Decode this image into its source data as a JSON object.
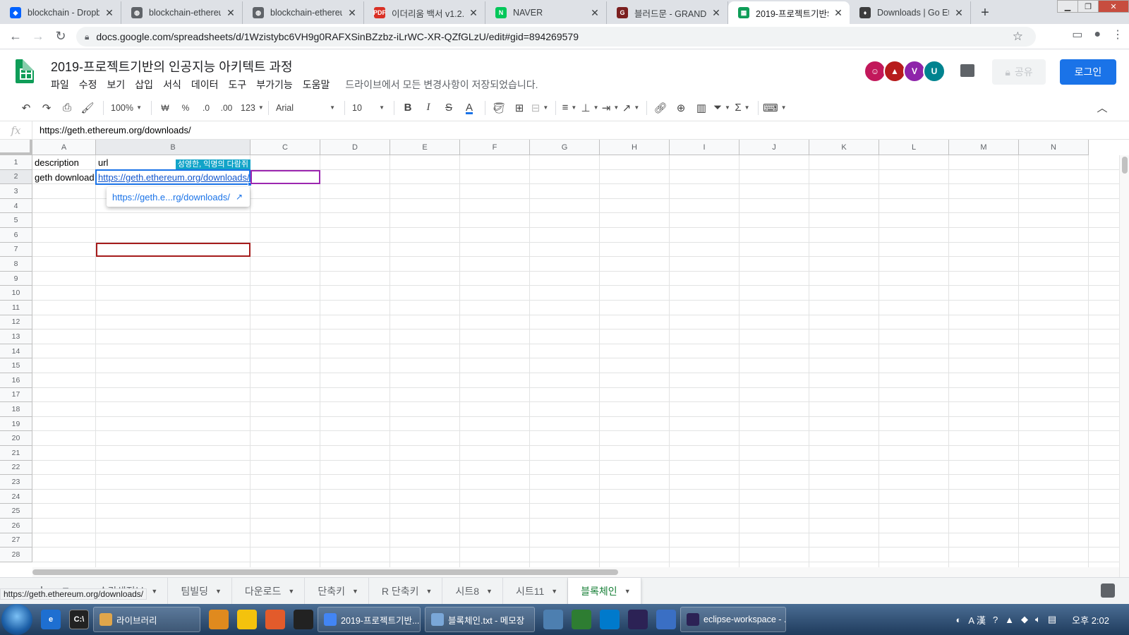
{
  "browser": {
    "tabs": [
      {
        "title": "blockchain - Dropbo",
        "icon": "dropbox-icon",
        "color": "#0061fe",
        "glyph": "◆"
      },
      {
        "title": "blockchain-ethereum",
        "icon": "globe-icon",
        "color": "#5f6368",
        "glyph": "◍"
      },
      {
        "title": "blockchain-ethereum",
        "icon": "globe-icon",
        "color": "#5f6368",
        "glyph": "◍"
      },
      {
        "title": "이더리움 백서 v1.2.p",
        "icon": "pdf-icon",
        "color": "#d93025",
        "glyph": "PDF"
      },
      {
        "title": "NAVER",
        "icon": "naver-icon",
        "color": "#03c75a",
        "glyph": "N"
      },
      {
        "title": "블러드문 - GRAND",
        "icon": "grand-icon",
        "color": "#7b1f1f",
        "glyph": "G"
      },
      {
        "title": "2019-프로젝트기반S",
        "icon": "sheets-icon",
        "color": "#0f9d58",
        "glyph": "▦",
        "active": true
      },
      {
        "title": "Downloads | Go Eth",
        "icon": "ethereum-icon",
        "color": "#3c3c3d",
        "glyph": "♦"
      }
    ],
    "url": "docs.google.com/spreadsheets/d/1Wzistybc6VH9g0RAFXSinBZzbz-iLrWC-XR-QZfGLzU/edit#gid=894269579"
  },
  "doc": {
    "title": "2019-프로젝트기반의 인공지능 아키텍트 과정",
    "menus": [
      "파일",
      "수정",
      "보기",
      "삽입",
      "서식",
      "데이터",
      "도구",
      "부가기능",
      "도움말"
    ],
    "saved_status": "드라이브에서 모든 변경사항이 저장되었습니다.",
    "share_label": "공유",
    "login_label": "로그인",
    "avatars": [
      {
        "color": "#c2185b",
        "glyph": "☺"
      },
      {
        "color": "#b71c1c",
        "glyph": "▲"
      },
      {
        "color": "#8e24aa",
        "glyph": "V"
      },
      {
        "color": "#00838f",
        "glyph": "U"
      }
    ]
  },
  "toolbar": {
    "zoom": "100%",
    "currency": "₩",
    "percent": "%",
    "dec_minus": ".0",
    "dec_plus": ".00",
    "format_more": "123",
    "font": "Arial",
    "font_size": "10",
    "bold": "B",
    "italic": "I",
    "strike": "S",
    "text_color": "A"
  },
  "formula": {
    "fx": "fx",
    "value": "https://geth.ethereum.org/downloads/"
  },
  "grid": {
    "columns": [
      "A",
      "B",
      "C",
      "D",
      "E",
      "F",
      "G",
      "H",
      "I",
      "J",
      "K",
      "L",
      "M",
      "N"
    ],
    "rows": [
      "1",
      "2",
      "3",
      "4",
      "5",
      "6",
      "7",
      "8",
      "9",
      "10",
      "11",
      "12",
      "13",
      "14",
      "15",
      "16",
      "17",
      "18",
      "19",
      "20",
      "21",
      "22",
      "23",
      "24",
      "25",
      "26",
      "27",
      "28"
    ],
    "cells": {
      "A1": "description",
      "B1": "url",
      "A2": "geth download",
      "B2": "https://geth.ethereum.org/downloads/"
    },
    "collaborator_label": "성영한, 익명의 다람쥐",
    "link_preview": "https://geth.e...rg/downloads/",
    "colors": {
      "selection": "#1a73e8",
      "collaborator": "#12a4c8",
      "collaborator_box": "#9c27b0",
      "other_selection": "#a61c1c"
    }
  },
  "sheets": {
    "tabs": [
      {
        "label": "수강생정보"
      },
      {
        "label": "팀빌딩"
      },
      {
        "label": "다운로드"
      },
      {
        "label": "단축키"
      },
      {
        "label": "R 단축키"
      },
      {
        "label": "시트8"
      },
      {
        "label": "시트11"
      },
      {
        "label": "블록체인",
        "active": true
      }
    ],
    "status_url": "https://geth.ethereum.org/downloads/"
  },
  "taskbar": {
    "items": [
      {
        "label": "라이브러리",
        "color": "#e0a64b"
      },
      {
        "label": "2019-프로젝트기반...",
        "color": "#4285f4"
      },
      {
        "label": "블록체인.txt - 메모장",
        "color": "#7aa7d8"
      },
      {
        "label": "eclipse-workspace - ...",
        "color": "#2c2255"
      }
    ],
    "ime": "A 漢",
    "clock": "오후 2:02"
  }
}
